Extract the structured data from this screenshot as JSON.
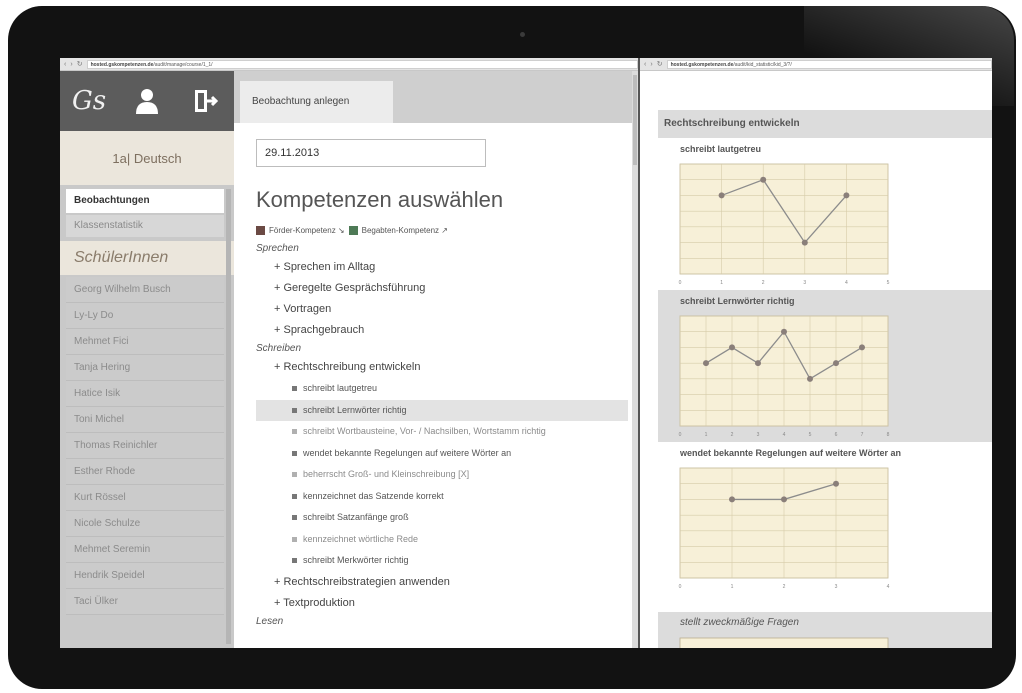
{
  "left_window": {
    "url": {
      "host": "hosted.gskompetenzen.de",
      "path": "/audit/manage/course/1_1/"
    }
  },
  "right_window": {
    "url": {
      "host": "hosted.gskompetenzen.de",
      "path": "/audit/kid_statistic/kid_3/?/"
    }
  },
  "app": {
    "logo": "Gs",
    "icons": [
      "user-icon",
      "logout-icon"
    ],
    "class_title": "1a| Deutsch",
    "nav": {
      "active": "Beobachtungen",
      "second": "Klassenstatistik"
    },
    "students_heading": "SchülerInnen",
    "students": [
      "Georg Wilhelm Busch",
      "Ly-Ly Do",
      "Mehmet Fici",
      "Tanja Hering",
      "Hatice Isik",
      "Toni Michel",
      "Thomas Reinichler",
      "Esther Rhode",
      "Kurt Rössel",
      "Nicole Schulze",
      "Mehmet Seremin",
      "Hendrik Speidel",
      "Taci Ülker"
    ]
  },
  "main": {
    "tab": "Beobachtung anlegen",
    "date": "29.11.2013",
    "heading": "Kompetenzen auswählen",
    "legend": {
      "foerder": "Förder-Kompetenz ↘",
      "begabten": "Begabten-Kompetenz ↗",
      "foerder_color": "#6b4a44",
      "begabten_color": "#4e7a56"
    },
    "tree": {
      "sprechen": "Sprechen",
      "sprechen_items": [
        "+ Sprechen im Alltag",
        "+ Geregelte Gesprächsführung",
        "+ Vortragen",
        "+ Sprachgebrauch"
      ],
      "schreiben": "Schreiben",
      "rechtschreibung": "+ Rechtschreibung entwickeln",
      "leaves": [
        {
          "text": "schreibt lautgetreu",
          "state": "normal"
        },
        {
          "text": "schreibt Lernwörter richtig",
          "state": "selected"
        },
        {
          "text": "schreibt Wortbausteine, Vor- / Nachsilben, Wortstamm richtig",
          "state": "dim"
        },
        {
          "text": "wendet bekannte Regelungen auf weitere Wörter an",
          "state": "normal"
        },
        {
          "text": "beherrscht Groß- und Kleinschreibung [X]",
          "state": "dim"
        },
        {
          "text": "kennzeichnet das Satzende korrekt",
          "state": "normal"
        },
        {
          "text": "schreibt Satzanfänge groß",
          "state": "normal"
        },
        {
          "text": "kennzeichnet wörtliche Rede",
          "state": "dim"
        },
        {
          "text": "schreibt Merkwörter richtig",
          "state": "normal"
        }
      ],
      "schreiben_more": [
        "+ Rechtschreibstrategien anwenden",
        "+ Textproduktion"
      ],
      "lesen": "Lesen"
    }
  },
  "stats": {
    "panel_title": "Rechtschreibung entwickeln",
    "next_title": "stellt zweckmäßige Fragen",
    "chart_bg": "#f7f0d8",
    "line_color": "#8c8c8c",
    "point_color": "#8a7f7a"
  },
  "chart_data": [
    {
      "type": "line",
      "title": "schreibt lautgetreu",
      "x": [
        1,
        2,
        3,
        4
      ],
      "y": [
        7,
        8,
        4,
        7
      ],
      "xlim": [
        0,
        5
      ],
      "ylim": [
        2,
        9
      ],
      "xticks": [
        "0",
        "1",
        "2",
        "3",
        "4",
        "5"
      ]
    },
    {
      "type": "line",
      "title": "schreibt Lernwörter richtig",
      "x": [
        1,
        2,
        3,
        4,
        5,
        6,
        7
      ],
      "y": [
        6,
        7,
        6,
        8,
        5,
        6,
        7
      ],
      "xlim": [
        0,
        8
      ],
      "ylim": [
        2,
        9
      ],
      "xticks": [
        "0",
        "1",
        "2",
        "3",
        "4",
        "5",
        "6",
        "7",
        "8"
      ]
    },
    {
      "type": "line",
      "title": "wendet bekannte Regelungen auf weitere Wörter an",
      "x": [
        1,
        2,
        3
      ],
      "y": [
        7,
        7,
        8
      ],
      "xlim": [
        0,
        4
      ],
      "ylim": [
        2,
        9
      ],
      "xticks": [
        "0",
        "1",
        "2",
        "3",
        "4"
      ]
    }
  ]
}
